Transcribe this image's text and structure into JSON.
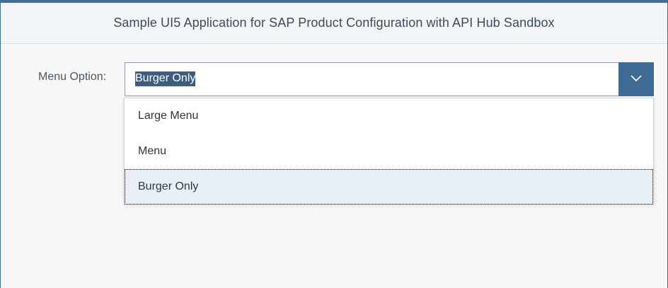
{
  "header": {
    "title": "Sample UI5 Application for SAP Product Configuration with API Hub Sandbox"
  },
  "form": {
    "menu_option_label": "Menu Option:",
    "menu_select": {
      "selected_value": "Burger Only",
      "options": [
        {
          "label": "Large Menu",
          "selected": false
        },
        {
          "label": "Menu",
          "selected": false
        },
        {
          "label": "Burger Only",
          "selected": true
        }
      ]
    }
  },
  "icons": {
    "select_arrow": "chevron-down-icon"
  },
  "colors": {
    "accent": "#3f6a94",
    "selection_highlight": "#3d5d80",
    "selected_item_bg": "#e8eff7",
    "header_bg": "#f2f5f8"
  }
}
